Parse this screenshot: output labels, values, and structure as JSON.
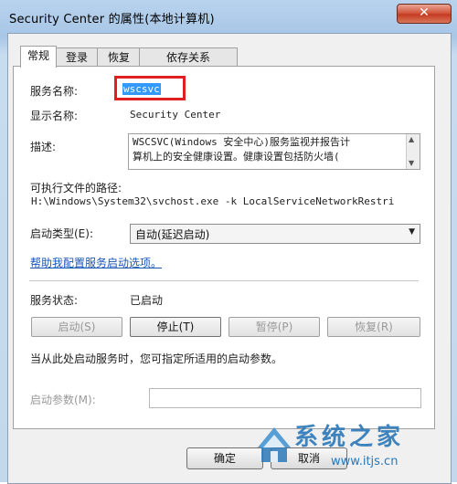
{
  "window": {
    "title": "Security Center 的属性(本地计算机)",
    "close_glyph": "✕"
  },
  "tabs": [
    {
      "label": "常规",
      "active": true
    },
    {
      "label": "登录",
      "active": false
    },
    {
      "label": "恢复",
      "active": false
    },
    {
      "label": "依存关系",
      "active": false
    }
  ],
  "general": {
    "service_name_label": "服务名称:",
    "service_name_value": "wscsvc",
    "display_name_label": "显示名称:",
    "display_name_value": "Security Center",
    "description_label": "描述:",
    "description_line1": "WSCSVC(Windows 安全中心)服务监视并报告计",
    "description_line2": "算机上的安全健康设置。健康设置包括防火墙(",
    "exe_path_label": "可执行文件的路径:",
    "exe_path_value": "H:\\Windows\\System32\\svchost.exe -k LocalServiceNetworkRestri",
    "startup_type_label": "启动类型(E):",
    "startup_type_value": "自动(延迟启动)",
    "help_link": "帮助我配置服务启动选项。",
    "status_label": "服务状态:",
    "status_value": "已启动",
    "buttons": {
      "start": "启动(S)",
      "stop": "停止(T)",
      "pause": "暂停(P)",
      "resume": "恢复(R)"
    },
    "hint_text": "当从此处启动服务时，您可指定所适用的启动参数。",
    "start_params_label": "启动参数(M):",
    "start_params_value": ""
  },
  "dialog_buttons": {
    "ok": "确定",
    "cancel": "取消"
  },
  "watermark": {
    "text": "系统之家",
    "url": "www.itjs.cn"
  },
  "colors": {
    "highlight_box": "#e02020",
    "selection": "#3399ff",
    "link": "#1a56b5",
    "watermark": "#2b78b8"
  }
}
